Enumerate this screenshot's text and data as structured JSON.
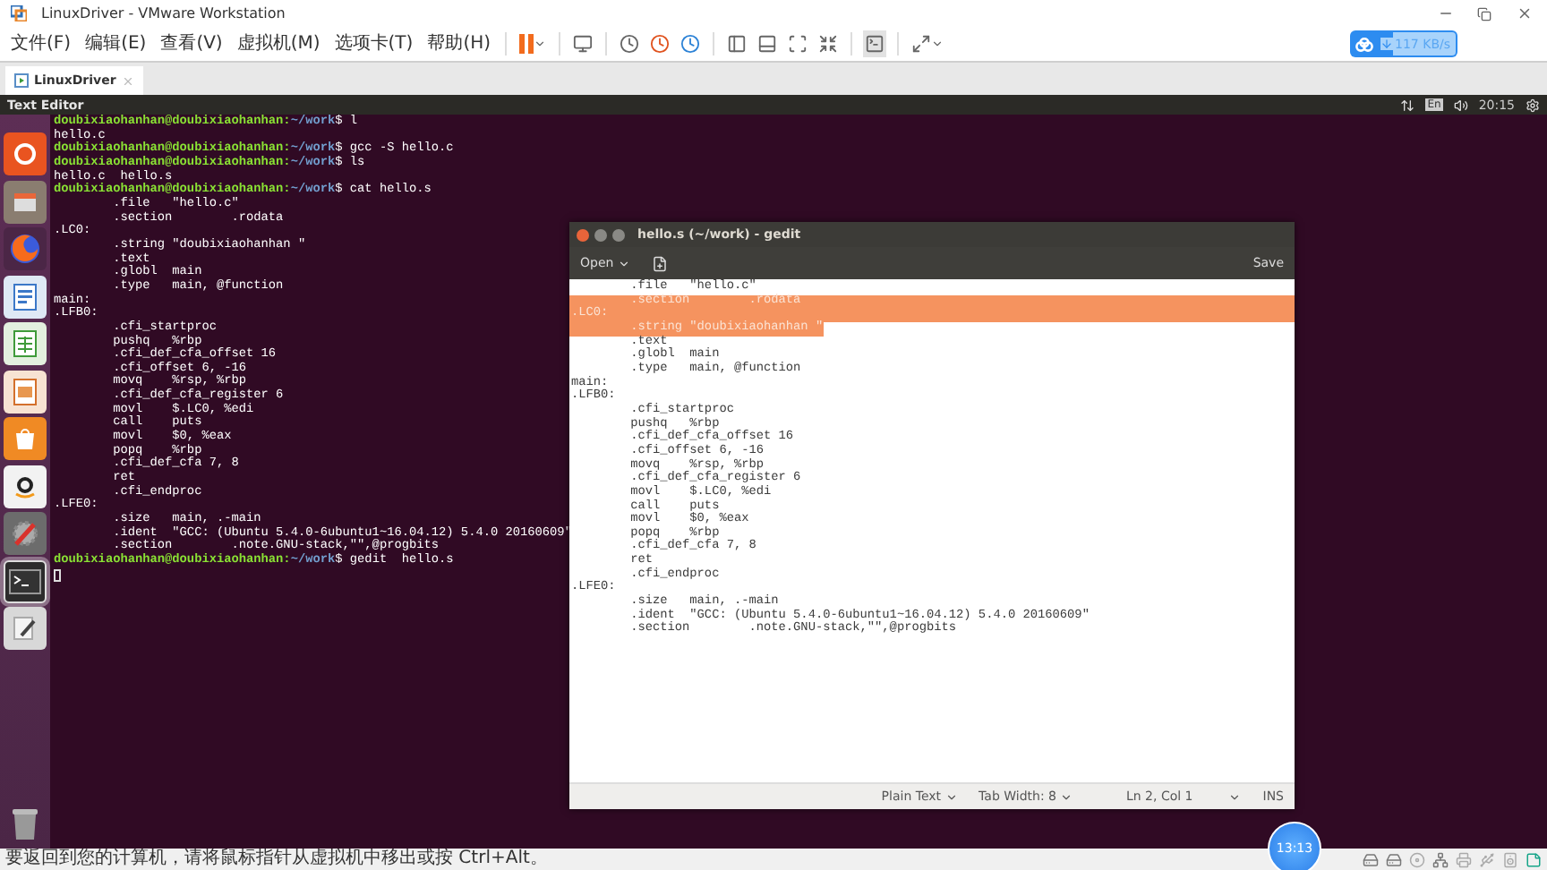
{
  "window": {
    "title": "LinuxDriver - VMware Workstation"
  },
  "menu": [
    "文件(F)",
    "编辑(E)",
    "查看(V)",
    "虚拟机(M)",
    "选项卡(T)",
    "帮助(H)"
  ],
  "net_speed": "117 KB/s",
  "tabs": [
    {
      "label": "LinuxDriver",
      "selected": true
    }
  ],
  "panel": {
    "title": "Text Editor",
    "keyboard": "En",
    "clock": "20:15"
  },
  "launcher": [
    {
      "kind": "dash",
      "selected": false
    },
    {
      "kind": "files",
      "selected": false
    },
    {
      "kind": "browser",
      "selected": false
    },
    {
      "kind": "writer",
      "selected": false
    },
    {
      "kind": "calc",
      "selected": false
    },
    {
      "kind": "impress",
      "selected": false
    },
    {
      "kind": "software",
      "selected": false
    },
    {
      "kind": "shop",
      "selected": false
    },
    {
      "kind": "settings",
      "selected": false
    },
    {
      "kind": "terminal",
      "selected": true
    },
    {
      "kind": "editor",
      "selected": false
    },
    {
      "kind": "trash",
      "selected": false
    }
  ],
  "terminal": {
    "lines": [
      {
        "kind": "prompt",
        "user": "doubixiaohanhan@doubixiaohanhan:",
        "path": "~/work",
        "command": "$ l"
      },
      {
        "kind": "output",
        "text": "hello.c"
      },
      {
        "kind": "prompt",
        "user": "doubixiaohanhan@doubixiaohanhan:",
        "path": "~/work",
        "command": "$ gcc -S hello.c"
      },
      {
        "kind": "prompt",
        "user": "doubixiaohanhan@doubixiaohanhan:",
        "path": "~/work",
        "command": "$ ls"
      },
      {
        "kind": "output",
        "text": "hello.c  hello.s"
      },
      {
        "kind": "prompt",
        "user": "doubixiaohanhan@doubixiaohanhan:",
        "path": "~/work",
        "command": "$ cat hello.s"
      },
      {
        "kind": "output",
        "text": "        .file   \"hello.c\""
      },
      {
        "kind": "output",
        "text": "        .section        .rodata"
      },
      {
        "kind": "output",
        "text": ".LC0:"
      },
      {
        "kind": "output",
        "text": "        .string \"doubixiaohanhan \""
      },
      {
        "kind": "output",
        "text": "        .text"
      },
      {
        "kind": "output",
        "text": "        .globl  main"
      },
      {
        "kind": "output",
        "text": "        .type   main, @function"
      },
      {
        "kind": "output",
        "text": "main:"
      },
      {
        "kind": "output",
        "text": ".LFB0:"
      },
      {
        "kind": "output",
        "text": "        .cfi_startproc"
      },
      {
        "kind": "output",
        "text": "        pushq   %rbp"
      },
      {
        "kind": "output",
        "text": "        .cfi_def_cfa_offset 16"
      },
      {
        "kind": "output",
        "text": "        .cfi_offset 6, -16"
      },
      {
        "kind": "output",
        "text": "        movq    %rsp, %rbp"
      },
      {
        "kind": "output",
        "text": "        .cfi_def_cfa_register 6"
      },
      {
        "kind": "output",
        "text": "        movl    $.LC0, %edi"
      },
      {
        "kind": "output",
        "text": "        call    puts"
      },
      {
        "kind": "output",
        "text": "        movl    $0, %eax"
      },
      {
        "kind": "output",
        "text": "        popq    %rbp"
      },
      {
        "kind": "output",
        "text": "        .cfi_def_cfa 7, 8"
      },
      {
        "kind": "output",
        "text": "        ret"
      },
      {
        "kind": "output",
        "text": "        .cfi_endproc"
      },
      {
        "kind": "output",
        "text": ".LFE0:"
      },
      {
        "kind": "output",
        "text": "        .size   main, .-main"
      },
      {
        "kind": "output",
        "text": "        .ident  \"GCC: (Ubuntu 5.4.0-6ubuntu1~16.04.12) 5.4.0 20160609\""
      },
      {
        "kind": "output",
        "text": "        .section        .note.GNU-stack,\"\",@progbits"
      },
      {
        "kind": "prompt",
        "user": "doubixiaohanhan@doubixiaohanhan:",
        "path": "~/work",
        "command": "$ gedit  hello.s"
      }
    ]
  },
  "gedit": {
    "title": "hello.s (~/work) - gedit",
    "open": "Open",
    "save": "Save",
    "lines": [
      {
        "text": "        .file   \"hello.c\"",
        "selected": false
      },
      {
        "text": "        .section        .rodata",
        "selected": true
      },
      {
        "text": ".LC0:",
        "selected": true
      },
      {
        "text": "        .string \"doubixiaohanhan \"",
        "selected": true
      },
      {
        "text": "        .text",
        "selected": false
      },
      {
        "text": "        .globl  main",
        "selected": false
      },
      {
        "text": "        .type   main, @function",
        "selected": false
      },
      {
        "text": "main:",
        "selected": false
      },
      {
        "text": ".LFB0:",
        "selected": false
      },
      {
        "text": "        .cfi_startproc",
        "selected": false
      },
      {
        "text": "        pushq   %rbp",
        "selected": false
      },
      {
        "text": "        .cfi_def_cfa_offset 16",
        "selected": false
      },
      {
        "text": "        .cfi_offset 6, -16",
        "selected": false
      },
      {
        "text": "        movq    %rsp, %rbp",
        "selected": false
      },
      {
        "text": "        .cfi_def_cfa_register 6",
        "selected": false
      },
      {
        "text": "        movl    $.LC0, %edi",
        "selected": false
      },
      {
        "text": "        call    puts",
        "selected": false
      },
      {
        "text": "        movl    $0, %eax",
        "selected": false
      },
      {
        "text": "        popq    %rbp",
        "selected": false
      },
      {
        "text": "        .cfi_def_cfa 7, 8",
        "selected": false
      },
      {
        "text": "        ret",
        "selected": false
      },
      {
        "text": "        .cfi_endproc",
        "selected": false
      },
      {
        "text": ".LFE0:",
        "selected": false
      },
      {
        "text": "        .size   main, .-main",
        "selected": false
      },
      {
        "text": "        .ident  \"GCC: (Ubuntu 5.4.0-6ubuntu1~16.04.12) 5.4.0 20160609\"",
        "selected": false
      },
      {
        "text": "        .section        .note.GNU-stack,\"\",@progbits",
        "selected": false
      }
    ],
    "status": {
      "language": "Plain Text",
      "tab_width": "Tab Width: 8",
      "position": "Ln 2, Col 1",
      "mode": "INS"
    }
  },
  "timer_badge": "13:13",
  "status_bar": {
    "message": "要返回到您的计算机，请将鼠标指针从虚拟机中移出或按 Ctrl+Alt。"
  }
}
